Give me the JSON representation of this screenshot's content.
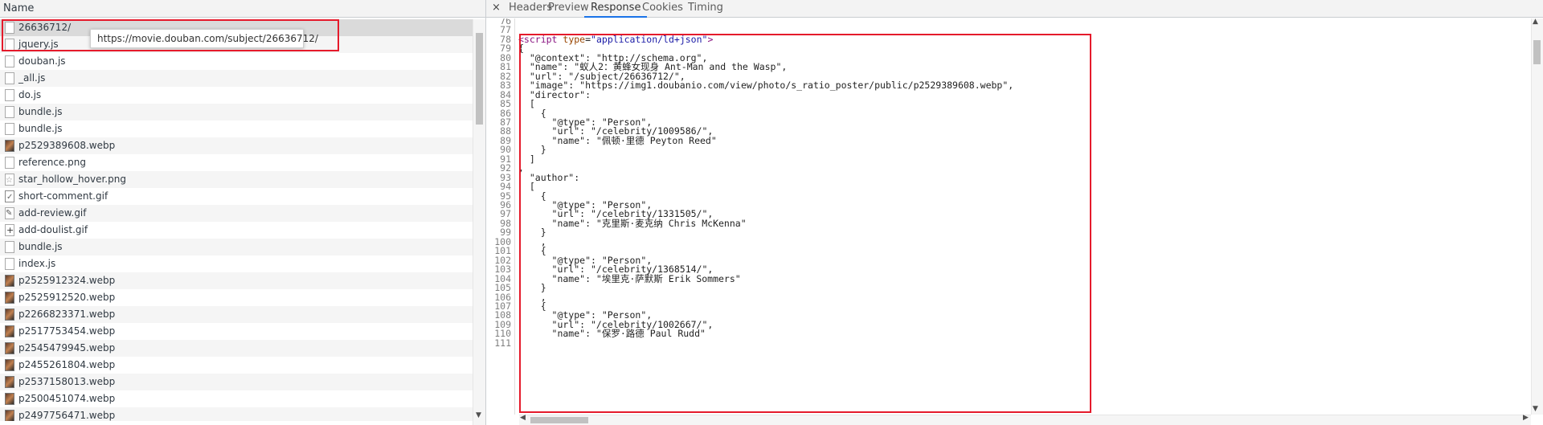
{
  "left_panel": {
    "header": "Name",
    "tooltip": "https://movie.douban.com/subject/26636712/",
    "rows": [
      {
        "name": "26636712/",
        "icon": "document-icon"
      },
      {
        "name": "jquery.js",
        "icon": "document-icon"
      },
      {
        "name": "douban.js",
        "icon": "document-icon"
      },
      {
        "name": "_all.js",
        "icon": "document-icon"
      },
      {
        "name": "do.js",
        "icon": "document-icon"
      },
      {
        "name": "bundle.js",
        "icon": "document-icon"
      },
      {
        "name": "bundle.js",
        "icon": "document-icon"
      },
      {
        "name": "p2529389608.webp",
        "icon": "image-thumbnail-icon"
      },
      {
        "name": "reference.png",
        "icon": "document-icon"
      },
      {
        "name": "star_hollow_hover.png",
        "icon": "star-image-icon"
      },
      {
        "name": "short-comment.gif",
        "icon": "comment-image-icon"
      },
      {
        "name": "add-review.gif",
        "icon": "pencil-image-icon"
      },
      {
        "name": "add-doulist.gif",
        "icon": "plus-image-icon"
      },
      {
        "name": "bundle.js",
        "icon": "document-icon"
      },
      {
        "name": "index.js",
        "icon": "document-icon"
      },
      {
        "name": "p2525912324.webp",
        "icon": "image-thumbnail-icon"
      },
      {
        "name": "p2525912520.webp",
        "icon": "image-thumbnail-icon"
      },
      {
        "name": "p2266823371.webp",
        "icon": "image-thumbnail-icon"
      },
      {
        "name": "p2517753454.webp",
        "icon": "image-thumbnail-icon"
      },
      {
        "name": "p2545479945.webp",
        "icon": "image-thumbnail-icon"
      },
      {
        "name": "p2455261804.webp",
        "icon": "image-thumbnail-icon"
      },
      {
        "name": "p2537158013.webp",
        "icon": "image-thumbnail-icon"
      },
      {
        "name": "p2500451074.webp",
        "icon": "image-thumbnail-icon"
      },
      {
        "name": "p2497756471.webp",
        "icon": "image-thumbnail-icon"
      }
    ]
  },
  "right_panel": {
    "close_label": "×",
    "tabs": [
      "Headers",
      "Preview",
      "Response",
      "Cookies",
      "Timing"
    ],
    "active_tab": "Response",
    "code_lines": [
      {
        "n": "76",
        "text": ""
      },
      {
        "n": "77",
        "text": ""
      },
      {
        "n": "78",
        "text": "<script type=\"application/ld+json\">"
      },
      {
        "n": "79",
        "text": "{"
      },
      {
        "n": "80",
        "text": "  \"@context\": \"http://schema.org\","
      },
      {
        "n": "81",
        "text": "  \"name\": \"蚁人2：黄蜂女现身 Ant-Man and the Wasp\","
      },
      {
        "n": "82",
        "text": "  \"url\": \"/subject/26636712/\","
      },
      {
        "n": "83",
        "text": "  \"image\": \"https://img1.doubanio.com/view/photo/s_ratio_poster/public/p2529389608.webp\","
      },
      {
        "n": "84",
        "text": "  \"director\":"
      },
      {
        "n": "85",
        "text": "  ["
      },
      {
        "n": "86",
        "text": "    {"
      },
      {
        "n": "87",
        "text": "      \"@type\": \"Person\","
      },
      {
        "n": "88",
        "text": "      \"url\": \"/celebrity/1009586/\","
      },
      {
        "n": "89",
        "text": "      \"name\": \"佩顿·里德 Peyton Reed\""
      },
      {
        "n": "90",
        "text": "    }"
      },
      {
        "n": "91",
        "text": "  ]"
      },
      {
        "n": "92",
        "text": ","
      },
      {
        "n": "93",
        "text": "  \"author\":"
      },
      {
        "n": "94",
        "text": "  ["
      },
      {
        "n": "95",
        "text": "    {"
      },
      {
        "n": "96",
        "text": "      \"@type\": \"Person\","
      },
      {
        "n": "97",
        "text": "      \"url\": \"/celebrity/1331505/\","
      },
      {
        "n": "98",
        "text": "      \"name\": \"克里斯·麦克纳 Chris McKenna\""
      },
      {
        "n": "99",
        "text": "    }"
      },
      {
        "n": "100",
        "text": "    ,"
      },
      {
        "n": "101",
        "text": "    {"
      },
      {
        "n": "102",
        "text": "      \"@type\": \"Person\","
      },
      {
        "n": "103",
        "text": "      \"url\": \"/celebrity/1368514/\","
      },
      {
        "n": "104",
        "text": "      \"name\": \"埃里克·萨默斯 Erik Sommers\""
      },
      {
        "n": "105",
        "text": "    }"
      },
      {
        "n": "106",
        "text": "    ,"
      },
      {
        "n": "107",
        "text": "    {"
      },
      {
        "n": "108",
        "text": "      \"@type\": \"Person\","
      },
      {
        "n": "109",
        "text": "      \"url\": \"/celebrity/1002667/\","
      },
      {
        "n": "110",
        "text": "      \"name\": \"保罗·路德 Paul Rudd\""
      },
      {
        "n": "111",
        "text": ""
      }
    ]
  },
  "colors": {
    "highlight": "#e51a2b",
    "active_tab_underline": "#1a73e8",
    "tag": "#881280",
    "attr": "#994500",
    "attr_value": "#1a1aa6"
  }
}
